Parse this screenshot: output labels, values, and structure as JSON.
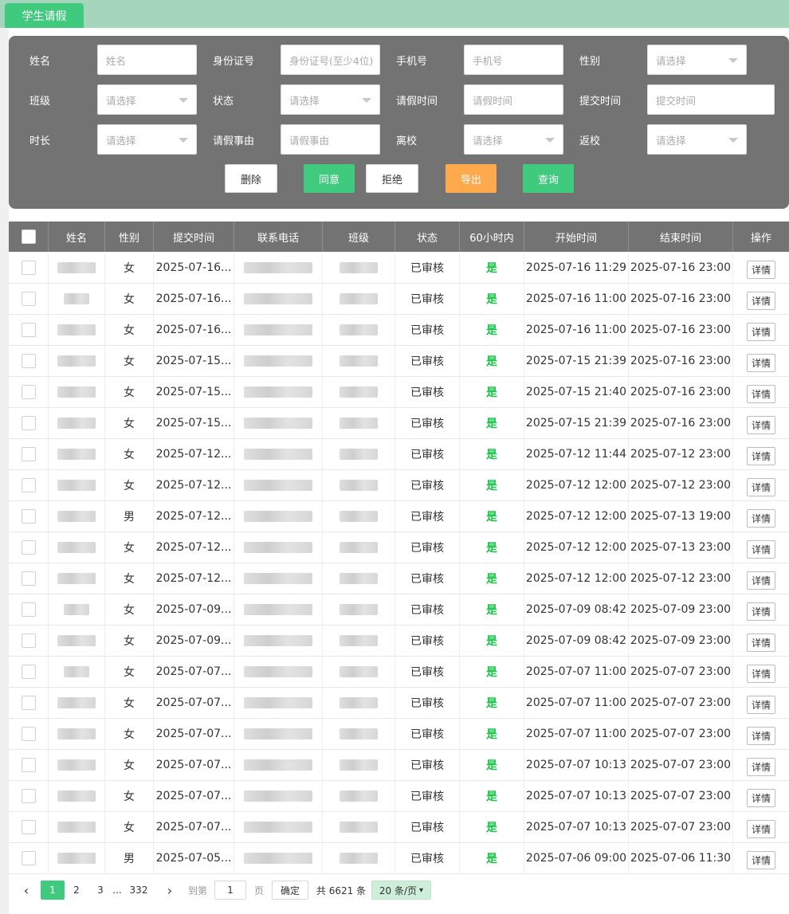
{
  "tab": {
    "label": "学生请假"
  },
  "filters": {
    "name": {
      "label": "姓名",
      "placeholder": "姓名"
    },
    "idcard": {
      "label": "身份证号",
      "placeholder": "身份证号(至少4位)"
    },
    "phone": {
      "label": "手机号",
      "placeholder": "手机号"
    },
    "gender": {
      "label": "性别",
      "placeholder": "请选择"
    },
    "clazz": {
      "label": "班级",
      "placeholder": "请选择"
    },
    "status": {
      "label": "状态",
      "placeholder": "请选择"
    },
    "leave_time": {
      "label": "请假时间",
      "placeholder": "请假时间"
    },
    "submit_time": {
      "label": "提交时间",
      "placeholder": "提交时间"
    },
    "duration": {
      "label": "时长",
      "placeholder": "请选择"
    },
    "reason": {
      "label": "请假事由",
      "placeholder": "请假事由"
    },
    "leave_school": {
      "label": "离校",
      "placeholder": "请选择"
    },
    "return_school": {
      "label": "返校",
      "placeholder": "请选择"
    }
  },
  "actions": {
    "delete": "删除",
    "approve": "同意",
    "reject": "拒绝",
    "export": "导出",
    "query": "查询"
  },
  "table": {
    "columns": [
      "姓名",
      "性别",
      "提交时间",
      "联系电话",
      "班级",
      "状态",
      "60小时内",
      "开始时间",
      "结束时间",
      "操作"
    ],
    "rows": [
      {
        "gender": "女",
        "submit": "2025-07-16...",
        "status": "已审核",
        "within60": "是",
        "start": "2025-07-16 11:29",
        "end": "2025-07-16 23:00",
        "action": "详情"
      },
      {
        "gender": "女",
        "submit": "2025-07-16...",
        "status": "已审核",
        "within60": "是",
        "start": "2025-07-16 11:00",
        "end": "2025-07-16 23:00",
        "action": "详情"
      },
      {
        "gender": "女",
        "submit": "2025-07-16...",
        "status": "已审核",
        "within60": "是",
        "start": "2025-07-16 11:00",
        "end": "2025-07-16 23:00",
        "action": "详情"
      },
      {
        "gender": "女",
        "submit": "2025-07-15...",
        "status": "已审核",
        "within60": "是",
        "start": "2025-07-15 21:39",
        "end": "2025-07-16 23:00",
        "action": "详情"
      },
      {
        "gender": "女",
        "submit": "2025-07-15...",
        "status": "已审核",
        "within60": "是",
        "start": "2025-07-15 21:40",
        "end": "2025-07-16 23:00",
        "action": "详情"
      },
      {
        "gender": "女",
        "submit": "2025-07-15...",
        "status": "已审核",
        "within60": "是",
        "start": "2025-07-15 21:39",
        "end": "2025-07-16 23:00",
        "action": "详情"
      },
      {
        "gender": "女",
        "submit": "2025-07-12...",
        "status": "已审核",
        "within60": "是",
        "start": "2025-07-12 11:44",
        "end": "2025-07-12 23:00",
        "action": "详情"
      },
      {
        "gender": "女",
        "submit": "2025-07-12...",
        "status": "已审核",
        "within60": "是",
        "start": "2025-07-12 12:00",
        "end": "2025-07-12 23:00",
        "action": "详情"
      },
      {
        "gender": "男",
        "submit": "2025-07-12...",
        "status": "已审核",
        "within60": "是",
        "start": "2025-07-12 12:00",
        "end": "2025-07-13 19:00",
        "action": "详情"
      },
      {
        "gender": "女",
        "submit": "2025-07-12...",
        "status": "已审核",
        "within60": "是",
        "start": "2025-07-12 12:00",
        "end": "2025-07-13 23:00",
        "action": "详情"
      },
      {
        "gender": "女",
        "submit": "2025-07-12...",
        "status": "已审核",
        "within60": "是",
        "start": "2025-07-12 12:00",
        "end": "2025-07-12 23:00",
        "action": "详情"
      },
      {
        "gender": "女",
        "submit": "2025-07-09...",
        "status": "已审核",
        "within60": "是",
        "start": "2025-07-09 08:42",
        "end": "2025-07-09 23:00",
        "action": "详情"
      },
      {
        "gender": "女",
        "submit": "2025-07-09...",
        "status": "已审核",
        "within60": "是",
        "start": "2025-07-09 08:42",
        "end": "2025-07-09 23:00",
        "action": "详情"
      },
      {
        "gender": "女",
        "submit": "2025-07-07...",
        "status": "已审核",
        "within60": "是",
        "start": "2025-07-07 11:00",
        "end": "2025-07-07 23:00",
        "action": "详情"
      },
      {
        "gender": "女",
        "submit": "2025-07-07...",
        "status": "已审核",
        "within60": "是",
        "start": "2025-07-07 11:00",
        "end": "2025-07-07 23:00",
        "action": "详情"
      },
      {
        "gender": "女",
        "submit": "2025-07-07...",
        "status": "已审核",
        "within60": "是",
        "start": "2025-07-07 11:00",
        "end": "2025-07-07 23:00",
        "action": "详情"
      },
      {
        "gender": "女",
        "submit": "2025-07-07...",
        "status": "已审核",
        "within60": "是",
        "start": "2025-07-07 10:13",
        "end": "2025-07-07 23:00",
        "action": "详情"
      },
      {
        "gender": "女",
        "submit": "2025-07-07...",
        "status": "已审核",
        "within60": "是",
        "start": "2025-07-07 10:13",
        "end": "2025-07-07 23:00",
        "action": "详情"
      },
      {
        "gender": "女",
        "submit": "2025-07-07...",
        "status": "已审核",
        "within60": "是",
        "start": "2025-07-07 10:13",
        "end": "2025-07-07 23:00",
        "action": "详情"
      },
      {
        "gender": "男",
        "submit": "2025-07-05...",
        "status": "已审核",
        "within60": "是",
        "start": "2025-07-06 09:00",
        "end": "2025-07-06 11:30",
        "action": "详情"
      }
    ]
  },
  "pagination": {
    "prev": "‹",
    "pages": [
      "1",
      "2",
      "3",
      "...",
      "332"
    ],
    "next": "›",
    "goto_label": "到第",
    "goto_value": "1",
    "page_unit": "页",
    "confirm": "确定",
    "total": "共 6621 条",
    "page_size": "20 条/页"
  },
  "colors": {
    "accent_green": "#3fca7e",
    "tab_bar": "#a5d6bb",
    "filter_bg": "#737373",
    "export_orange": "#ffa94d",
    "yes_green": "#1dc34b"
  }
}
